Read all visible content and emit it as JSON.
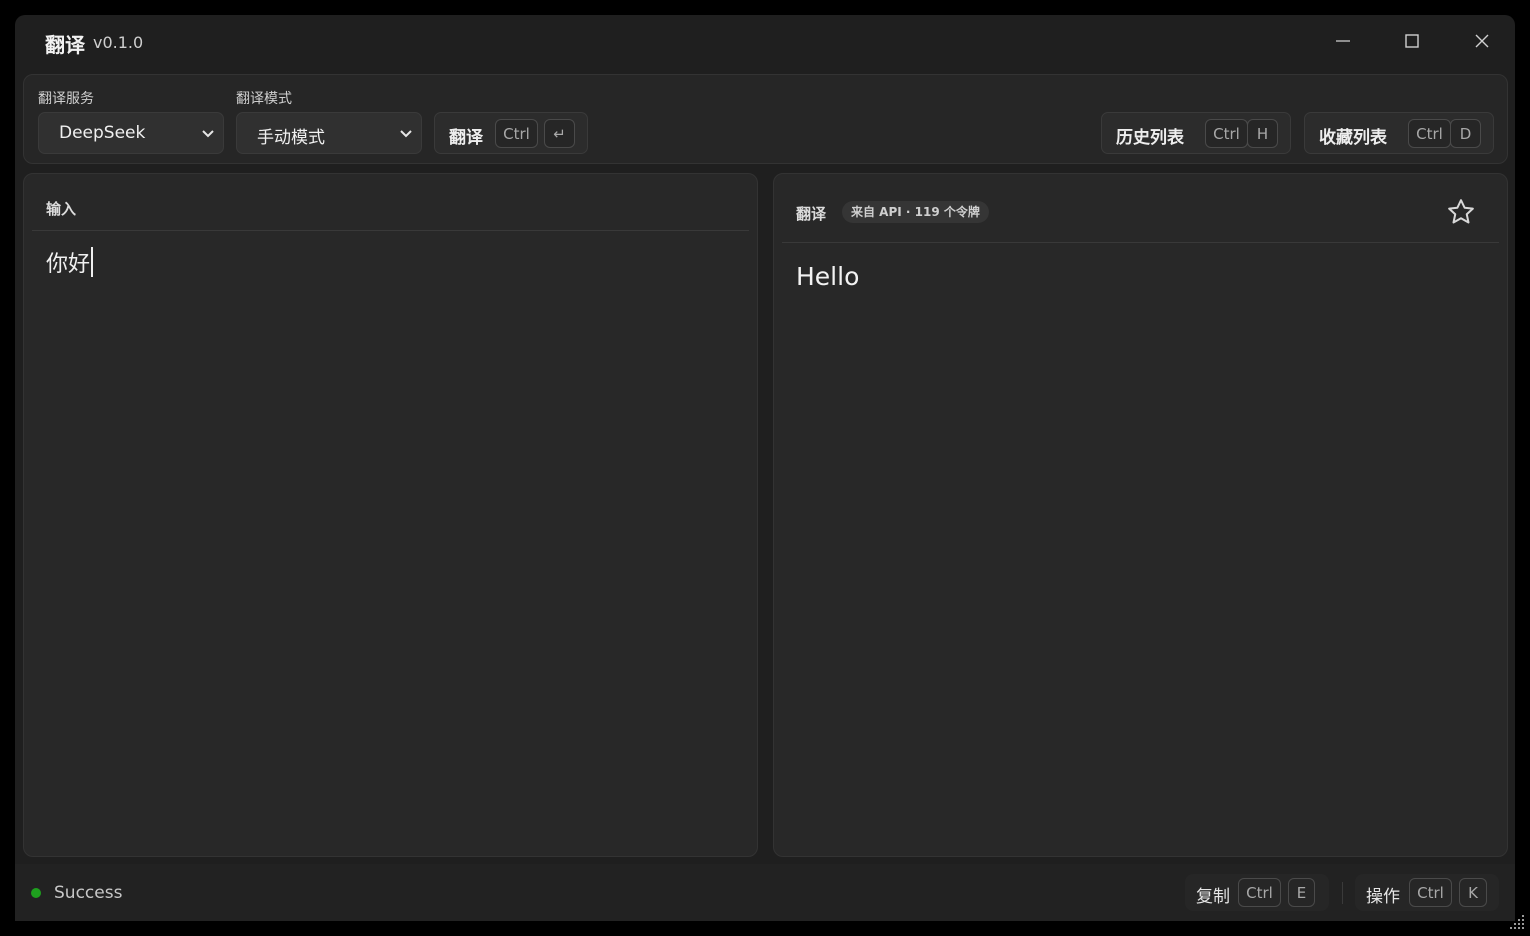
{
  "window": {
    "title": "翻译",
    "version": "v0.1.0",
    "controls": [
      "minimize-icon",
      "maximize-icon",
      "close-icon"
    ]
  },
  "toolbar": {
    "service_label": "翻译服务",
    "service_value": "DeepSeek",
    "mode_label": "翻译模式",
    "mode_value": "手动模式",
    "translate_button": {
      "label": "翻译",
      "key1": "Ctrl",
      "key2": "↵"
    },
    "history_button": {
      "label": "历史列表",
      "key1": "Ctrl",
      "key2": "H"
    },
    "favorites_button": {
      "label": "收藏列表",
      "key1": "Ctrl",
      "key2": "D"
    }
  },
  "input_panel": {
    "title": "输入",
    "text": "你好"
  },
  "output_panel": {
    "title": "翻译",
    "badge": "来自 API · 119 个令牌",
    "text": "Hello",
    "favorite_icon": "star-outline-icon"
  },
  "statusbar": {
    "status": "Success",
    "status_color": "#1ea01e",
    "copy_button": {
      "label": "复制",
      "key1": "Ctrl",
      "key2": "E"
    },
    "actions_button": {
      "label": "操作",
      "key1": "Ctrl",
      "key2": "K"
    }
  }
}
